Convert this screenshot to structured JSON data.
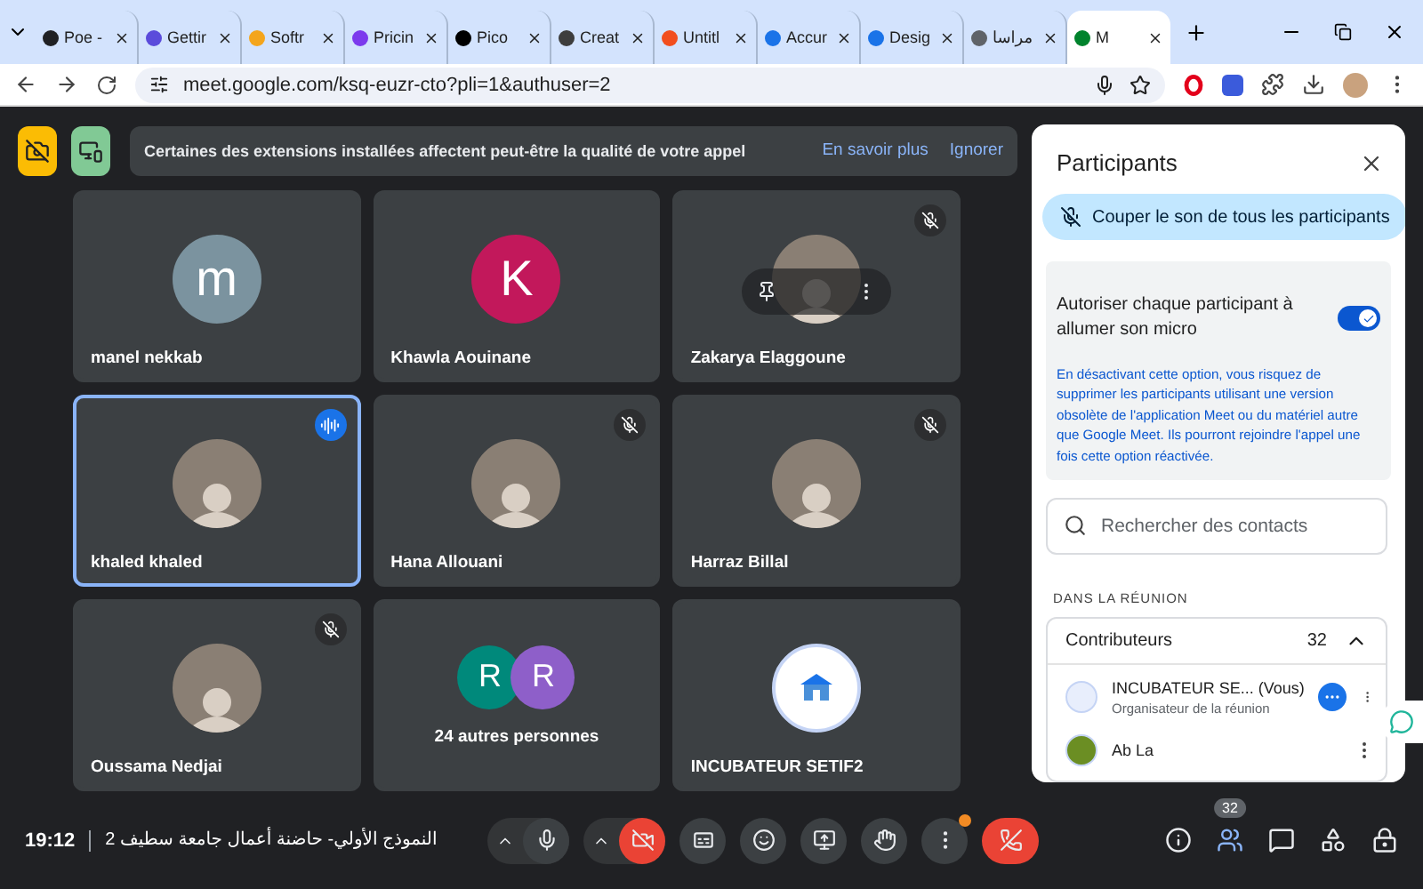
{
  "browser": {
    "tabs": [
      {
        "title": "Poe -",
        "color": "#202124",
        "selected": false
      },
      {
        "title": "Gettir",
        "color": "#5b4bdb",
        "selected": false
      },
      {
        "title": "Softr",
        "color": "#f4a51c",
        "selected": false
      },
      {
        "title": "Pricin",
        "color": "#7c3aed",
        "selected": false
      },
      {
        "title": "Pico",
        "color": "#000000",
        "selected": false
      },
      {
        "title": "Creat",
        "color": "#3d3d3d",
        "selected": false
      },
      {
        "title": "Untitl",
        "color": "#f24e1e",
        "selected": false
      },
      {
        "title": "Accur",
        "color": "#1a73e8",
        "selected": false
      },
      {
        "title": "Desig",
        "color": "#1a73e8",
        "selected": false
      },
      {
        "title": "مراسا",
        "color": "#5f6368",
        "selected": false
      },
      {
        "title": "M",
        "color": "#00832d",
        "selected": true
      }
    ],
    "url": "meet.google.com/ksq-euzr-cto?pli=1&authuser=2"
  },
  "banner": {
    "message": "Certaines des extensions installées affectent peut-être la qualité de votre appel",
    "actions": [
      "En savoir plus",
      "Ignorer"
    ]
  },
  "tiles": [
    {
      "name": "manel nekkab",
      "kind": "letter",
      "letter": "m",
      "color": "#7b939f",
      "muted": false,
      "speaking": false,
      "hovered": false
    },
    {
      "name": "Khawla Aouinane",
      "kind": "letter",
      "letter": "K",
      "color": "#c2185b",
      "muted": false,
      "speaking": false,
      "hovered": false
    },
    {
      "name": "Zakarya Elaggoune",
      "kind": "photo",
      "muted": true,
      "speaking": false,
      "hovered": true
    },
    {
      "name": "khaled khaled",
      "kind": "photo",
      "muted": false,
      "speaking": true,
      "hovered": false
    },
    {
      "name": "Hana Allouani",
      "kind": "photo",
      "muted": true,
      "speaking": false,
      "hovered": false
    },
    {
      "name": "Harraz Billal",
      "kind": "photo",
      "muted": true,
      "speaking": false,
      "hovered": false
    },
    {
      "name": "Oussama Nedjai",
      "kind": "photo",
      "muted": true,
      "speaking": false,
      "hovered": false
    },
    {
      "name": "24 autres personnes",
      "kind": "group",
      "letters": [
        {
          "letter": "R",
          "color": "#00897b"
        },
        {
          "letter": "R",
          "color": "#8e5fc9"
        }
      ],
      "muted": false,
      "speaking": false,
      "hovered": false
    },
    {
      "name": "INCUBATEUR SETIF2",
      "kind": "logo",
      "muted": false,
      "speaking": false,
      "hovered": false
    }
  ],
  "panel": {
    "title": "Participants",
    "mute_all": "Couper le son de tous les participants",
    "mic_setting": {
      "label": "Autoriser chaque participant à allumer son micro",
      "on": true,
      "note": "En désactivant cette option, vous risquez de supprimer les participants utilisant une version obsolète de l'application Meet ou du matériel autre que Google Meet. Ils pourront rejoindre l'appel une fois cette option réactivée."
    },
    "search": {
      "placeholder": "Rechercher des contacts"
    },
    "section": "DANS LA RÉUNION",
    "group": {
      "label": "Contributeurs",
      "count": "32",
      "expanded": true,
      "members": [
        {
          "name": "INCUBATEUR SE...",
          "tag": "(Vous)",
          "role": "Organisateur de la réunion",
          "kind": "logo"
        },
        {
          "name": "Ab La",
          "kind": "photo"
        }
      ]
    }
  },
  "bottom": {
    "time": "19:12",
    "meeting_title": "النموذج الأولي- حاضنة أعمال جامعة سطيف 2",
    "mic_on": true,
    "camera_on": false,
    "more_alert": true,
    "participant_count": "32"
  }
}
